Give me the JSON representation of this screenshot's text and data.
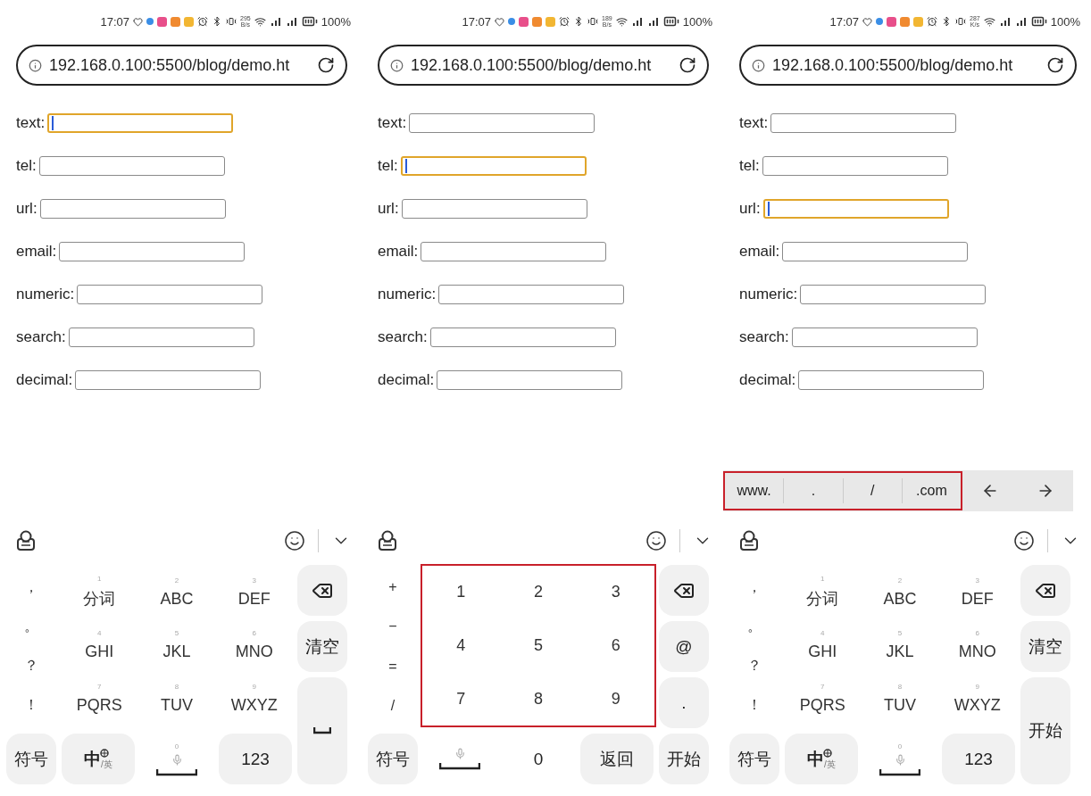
{
  "panels": [
    {
      "status_bar": {
        "time": "17:07",
        "speed": "295",
        "speed_unit": "B/s",
        "battery": "100%"
      },
      "address_bar": {
        "url": "192.168.0.100:5500/blog/demo.ht"
      },
      "fields": [
        {
          "label": "text:",
          "focused": true
        },
        {
          "label": "tel:",
          "focused": false
        },
        {
          "label": "url:",
          "focused": false
        },
        {
          "label": "email:",
          "focused": false
        },
        {
          "label": "numeric:",
          "focused": false
        },
        {
          "label": "search:",
          "focused": false
        },
        {
          "label": "decimal:",
          "focused": false
        }
      ],
      "keyboard": {
        "kind": "t9",
        "grid_highlighted": false,
        "side_keys": [
          "，",
          "。",
          "？",
          "！"
        ],
        "grid_keys": [
          {
            "digit": "1",
            "label": "分词"
          },
          {
            "digit": "2",
            "label": "ABC"
          },
          {
            "digit": "3",
            "label": "DEF"
          },
          {
            "digit": "4",
            "label": "GHI"
          },
          {
            "digit": "5",
            "label": "JKL"
          },
          {
            "digit": "6",
            "label": "MNO"
          },
          {
            "digit": "7",
            "label": "PQRS"
          },
          {
            "digit": "8",
            "label": "TUV"
          },
          {
            "digit": "9",
            "label": "WXYZ"
          }
        ],
        "right_keys": [
          {
            "kind": "backspace"
          },
          {
            "kind": "label",
            "label": "清空"
          },
          {
            "kind": "space"
          }
        ],
        "bottom_keys": [
          {
            "kind": "label",
            "label": "符号"
          },
          {
            "kind": "lang",
            "label": "中",
            "sub": "/英"
          },
          {
            "kind": "space",
            "digit": "0"
          },
          {
            "kind": "label",
            "label": "123"
          }
        ]
      }
    },
    {
      "status_bar": {
        "time": "17:07",
        "speed": "189",
        "speed_unit": "B/s",
        "battery": "100%"
      },
      "address_bar": {
        "url": "192.168.0.100:5500/blog/demo.ht"
      },
      "fields": [
        {
          "label": "text:",
          "focused": false
        },
        {
          "label": "tel:",
          "focused": true
        },
        {
          "label": "url:",
          "focused": false
        },
        {
          "label": "email:",
          "focused": false
        },
        {
          "label": "numeric:",
          "focused": false
        },
        {
          "label": "search:",
          "focused": false
        },
        {
          "label": "decimal:",
          "focused": false
        }
      ],
      "keyboard": {
        "kind": "numeric",
        "grid_highlighted": true,
        "side_keys": [
          "+",
          "−",
          "=",
          "/"
        ],
        "grid_keys": [
          {
            "label": "1"
          },
          {
            "label": "2"
          },
          {
            "label": "3"
          },
          {
            "label": "4"
          },
          {
            "label": "5"
          },
          {
            "label": "6"
          },
          {
            "label": "7"
          },
          {
            "label": "8"
          },
          {
            "label": "9"
          }
        ],
        "right_keys": [
          {
            "kind": "backspace"
          },
          {
            "kind": "label",
            "label": "@"
          },
          {
            "kind": "label",
            "label": "."
          },
          {
            "kind": "label",
            "label": "开始"
          }
        ],
        "bottom_keys": [
          {
            "kind": "label",
            "label": "符号"
          },
          {
            "kind": "space"
          },
          {
            "kind": "plain",
            "label": "0"
          },
          {
            "kind": "label",
            "label": "返回"
          }
        ]
      }
    },
    {
      "status_bar": {
        "time": "17:07",
        "speed": "287",
        "speed_unit": "K/s",
        "battery": "100%"
      },
      "address_bar": {
        "url": "192.168.0.100:5500/blog/demo.ht"
      },
      "fields": [
        {
          "label": "text:",
          "focused": false
        },
        {
          "label": "tel:",
          "focused": false
        },
        {
          "label": "url:",
          "focused": true
        },
        {
          "label": "email:",
          "focused": false
        },
        {
          "label": "numeric:",
          "focused": false
        },
        {
          "label": "search:",
          "focused": false
        },
        {
          "label": "decimal:",
          "focused": false
        }
      ],
      "suggestion_bar": {
        "highlighted": true,
        "items": [
          "www.",
          ".",
          "/",
          ".com"
        ]
      },
      "keyboard": {
        "kind": "t9",
        "grid_highlighted": false,
        "side_keys": [
          "，",
          "。",
          "？",
          "！"
        ],
        "grid_keys": [
          {
            "digit": "1",
            "label": "分词"
          },
          {
            "digit": "2",
            "label": "ABC"
          },
          {
            "digit": "3",
            "label": "DEF"
          },
          {
            "digit": "4",
            "label": "GHI"
          },
          {
            "digit": "5",
            "label": "JKL"
          },
          {
            "digit": "6",
            "label": "MNO"
          },
          {
            "digit": "7",
            "label": "PQRS"
          },
          {
            "digit": "8",
            "label": "TUV"
          },
          {
            "digit": "9",
            "label": "WXYZ"
          }
        ],
        "right_keys": [
          {
            "kind": "backspace"
          },
          {
            "kind": "label",
            "label": "清空"
          },
          {
            "kind": "label",
            "label": "开始"
          }
        ],
        "bottom_keys": [
          {
            "kind": "label",
            "label": "符号"
          },
          {
            "kind": "lang",
            "label": "中",
            "sub": "/英"
          },
          {
            "kind": "space",
            "digit": "0"
          },
          {
            "kind": "label",
            "label": "123"
          }
        ]
      }
    }
  ]
}
